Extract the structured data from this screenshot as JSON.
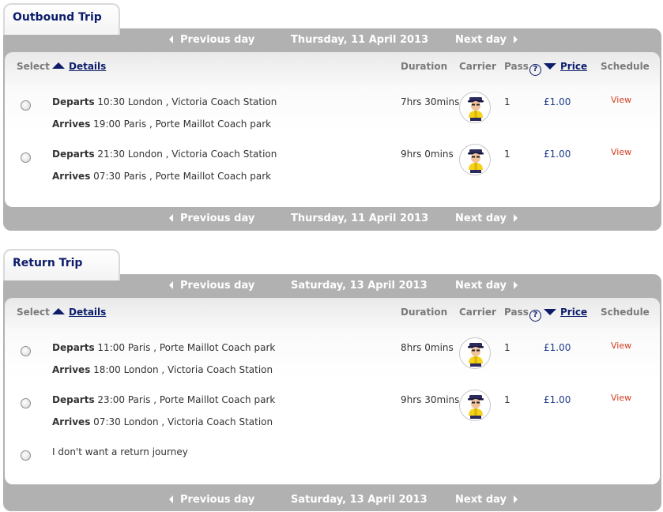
{
  "outbound": {
    "title": "Outbound Trip",
    "date": "Thursday, 11 April 2013",
    "prev": "Previous day",
    "next": "Next day",
    "headers": {
      "select": "Select",
      "details": "Details",
      "duration": "Duration",
      "carrier": "Carrier",
      "pass": "Pass",
      "pass_help": "?",
      "price": "Price",
      "schedule": "Schedule"
    },
    "journeys": [
      {
        "departs_label": "Departs",
        "departs": "10:30 London , Victoria Coach Station",
        "arrives_label": "Arrives",
        "arrives": "19:00 Paris , Porte Maillot Coach park",
        "duration": "7hrs 30mins",
        "pass": "1",
        "price": "£1.00",
        "schedule": "View"
      },
      {
        "departs_label": "Departs",
        "departs": "21:30 London , Victoria Coach Station",
        "arrives_label": "Arrives",
        "arrives": "07:30 Paris , Porte Maillot Coach park",
        "duration": "9hrs 0mins",
        "pass": "1",
        "price": "£1.00",
        "schedule": "View"
      }
    ]
  },
  "return": {
    "title": "Return Trip",
    "date": "Saturday, 13 April 2013",
    "prev": "Previous day",
    "next": "Next day",
    "headers": {
      "select": "Select",
      "details": "Details",
      "duration": "Duration",
      "carrier": "Carrier",
      "pass": "Pass",
      "pass_help": "?",
      "price": "Price",
      "schedule": "Schedule"
    },
    "journeys": [
      {
        "departs_label": "Departs",
        "departs": "11:00 Paris , Porte Maillot Coach park",
        "arrives_label": "Arrives",
        "arrives": "18:00 London , Victoria Coach Station",
        "duration": "8hrs 0mins",
        "pass": "1",
        "price": "£1.00",
        "schedule": "View"
      },
      {
        "departs_label": "Departs",
        "departs": "23:00 Paris , Porte Maillot Coach park",
        "arrives_label": "Arrives",
        "arrives": "07:30 London , Victoria Coach Station",
        "duration": "9hrs 30mins",
        "pass": "1",
        "price": "£1.00",
        "schedule": "View"
      }
    ],
    "no_return_label": "I don't want a return journey"
  },
  "icons": {
    "carrier": "coach-driver-mascot-icon",
    "prev": "triangle-left-icon",
    "next": "triangle-right-icon",
    "sort_details": "triangle-up-icon",
    "sort_price": "triangle-down-icon",
    "help": "question-circle-icon"
  },
  "colors": {
    "title": "#0d1d6b",
    "frame": "#b1b1b1",
    "price": "#1f3d8a",
    "view_link": "#d23c1e"
  }
}
